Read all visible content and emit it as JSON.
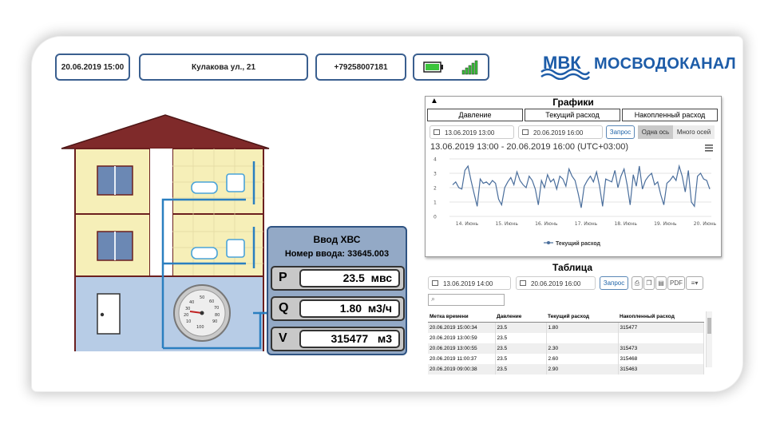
{
  "header": {
    "datetime": "20.06.2019 15:00",
    "address": "Кулакова ул., 21",
    "phone": "+79258007181",
    "logo_mark": "МВК",
    "logo_text": "МОСВОДОКАНАЛ"
  },
  "input_panel": {
    "title": "Ввод ХВС",
    "number_label": "Номер ввода:",
    "number_value": "33645.003",
    "rows": [
      {
        "label": "P",
        "value": "23.5",
        "unit": "мвс"
      },
      {
        "label": "Q",
        "value": "1.80",
        "unit": "м3/ч"
      },
      {
        "label": "V",
        "value": "315477",
        "unit": "м3"
      }
    ]
  },
  "gauge": {
    "ticks": [
      "10",
      "20",
      "30",
      "40",
      "50",
      "60",
      "70",
      "80",
      "90",
      "100"
    ]
  },
  "charts": {
    "title": "Графики",
    "collapse_icon": "triangle-up-icon",
    "tabs": [
      "Давление",
      "Текущий расход",
      "Накопленный расход"
    ],
    "date_from": "13.06.2019 13:00",
    "date_to": "20.06.2019 16:00",
    "query_button": "Запрос",
    "axis_mode": [
      "Одна ось",
      "Много осей"
    ]
  },
  "chart_data": {
    "type": "line",
    "title": "13.06.2019 13:00 - 20.06.2019 16:00 (UTC+03:00)",
    "x_tick_labels": [
      "14. Июнь",
      "15. Июнь",
      "16. Июнь",
      "17. Июнь",
      "18. Июнь",
      "19. Июнь",
      "20. Июнь"
    ],
    "ylim": [
      0,
      4
    ],
    "y_ticks": [
      "0",
      "1",
      "2",
      "3",
      "4"
    ],
    "grid": true,
    "legend": "bottom",
    "series": [
      {
        "name": "Текущий расход",
        "color": "#4a6e9c",
        "values": [
          2.2,
          2.4,
          2.0,
          1.9,
          3.2,
          3.5,
          2.5,
          1.6,
          0.7,
          2.6,
          2.3,
          2.4,
          2.2,
          2.5,
          2.3,
          1.2,
          0.8,
          2.0,
          2.4,
          2.7,
          2.2,
          3.1,
          2.5,
          2.2,
          2.0,
          2.8,
          2.5,
          1.9,
          0.8,
          2.5,
          2.0,
          2.9,
          2.4,
          2.6,
          1.9,
          2.8,
          2.6,
          2.1,
          3.3,
          2.8,
          2.5,
          1.6,
          0.6,
          2.1,
          2.5,
          2.8,
          2.4,
          3.1,
          2.1,
          0.7,
          2.6,
          2.5,
          2.4,
          3.2,
          2.0,
          2.8,
          3.3,
          2.2,
          0.8,
          2.9,
          2.1,
          3.5,
          1.9,
          2.5,
          2.8,
          3.0,
          2.2,
          2.4,
          1.5,
          0.8,
          2.3,
          2.5,
          2.8,
          2.5,
          3.5,
          2.8,
          1.7,
          3.2,
          1.0,
          0.7,
          2.8,
          3.0,
          2.6,
          2.5,
          1.9
        ]
      }
    ]
  },
  "table": {
    "title": "Таблица",
    "date_from": "13.06.2019 14:00",
    "date_to": "20.06.2019 16:00",
    "query_button": "Запрос",
    "pdf_label": "PDF",
    "columns": [
      "Метка времени",
      "Давление",
      "Текущий расход",
      "Накопленный расход"
    ],
    "rows": [
      [
        "20.06.2019 15:00:34",
        "23.5",
        "1.80",
        "315477"
      ],
      [
        "20.06.2019 13:00:59",
        "23.5",
        "",
        ""
      ],
      [
        "20.06.2019 13:00:55",
        "23.5",
        "2.30",
        "315473"
      ],
      [
        "20.06.2019 11:00:37",
        "23.5",
        "2.60",
        "315468"
      ],
      [
        "20.06.2019 09:00:38",
        "23.5",
        "2.90",
        "315463"
      ]
    ]
  }
}
